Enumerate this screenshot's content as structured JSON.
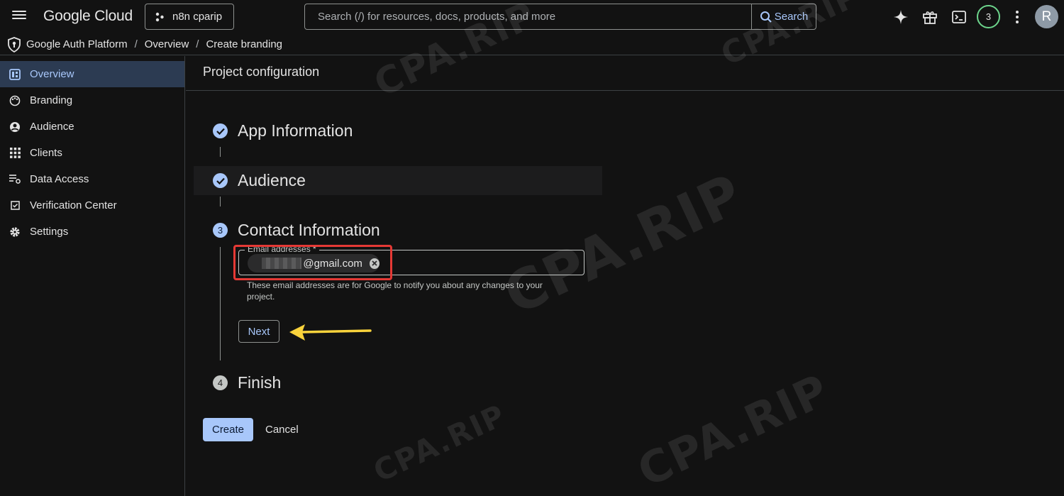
{
  "app": {
    "logo": "Google Cloud"
  },
  "project": {
    "name": "n8n cparip"
  },
  "search": {
    "placeholder": "Search (/) for resources, docs, products, and more",
    "button_label": "Search"
  },
  "header": {
    "notifications_count": "3",
    "avatar_initial": "R"
  },
  "breadcrumb": {
    "items": [
      "Google Auth Platform",
      "Overview",
      "Create branding"
    ],
    "separator": "/"
  },
  "sidebar": {
    "items": [
      {
        "label": "Overview",
        "icon": "dashboard-icon",
        "active": true
      },
      {
        "label": "Branding",
        "icon": "palette-icon"
      },
      {
        "label": "Audience",
        "icon": "person-icon"
      },
      {
        "label": "Clients",
        "icon": "grid-icon"
      },
      {
        "label": "Data Access",
        "icon": "data-access-icon"
      },
      {
        "label": "Verification Center",
        "icon": "checkbox-icon"
      },
      {
        "label": "Settings",
        "icon": "gear-icon"
      }
    ]
  },
  "main": {
    "title": "Project configuration",
    "steps": [
      {
        "label": "App Information",
        "status": "done"
      },
      {
        "label": "Audience",
        "status": "done"
      },
      {
        "number": "3",
        "label": "Contact Information",
        "status": "current"
      },
      {
        "number": "4",
        "label": "Finish",
        "status": "todo"
      }
    ],
    "email": {
      "label": "Email addresses *",
      "chip_text": "@gmail.com",
      "helper": "These email addresses are for Google to notify you about any changes to your project."
    },
    "next_label": "Next",
    "create_label": "Create",
    "cancel_label": "Cancel"
  },
  "watermark": {
    "text": "CPA.RIP"
  },
  "colors": {
    "accent": "#a8c7fa",
    "highlight": "#e53935",
    "arrow": "#f9d33c",
    "notif_ring": "#6dd58c"
  }
}
